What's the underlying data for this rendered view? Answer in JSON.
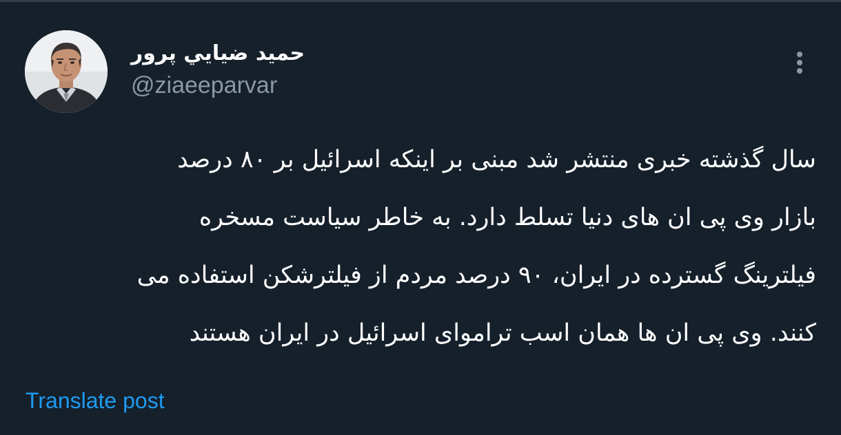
{
  "post": {
    "author": {
      "display_name": "حمید ضيايي پرور",
      "handle": "@ziaeeparvar",
      "avatar_icon": "profile-photo"
    },
    "more_icon": "vertical-ellipsis-icon",
    "text_lines": [
      "سال گذشته خبری منتشر شد مبنی بر اینکه اسرائیل بر ۸۰ درصد",
      "بازار وی پی ان های دنیا تسلط دارد. به خاطر سیاست مسخره",
      "فیلترینگ گسترده در ایران، ۹۰ درصد مردم از فیلترشکن استفاده می",
      "کنند. وی پی ان ها همان اسب تراموای اسرائیل در ایران هستند"
    ],
    "translate_label": "Translate post"
  },
  "colors": {
    "background": "#15202b",
    "text": "#ffffff",
    "secondary_text": "#8b98a5",
    "link": "#1d9bf0"
  }
}
